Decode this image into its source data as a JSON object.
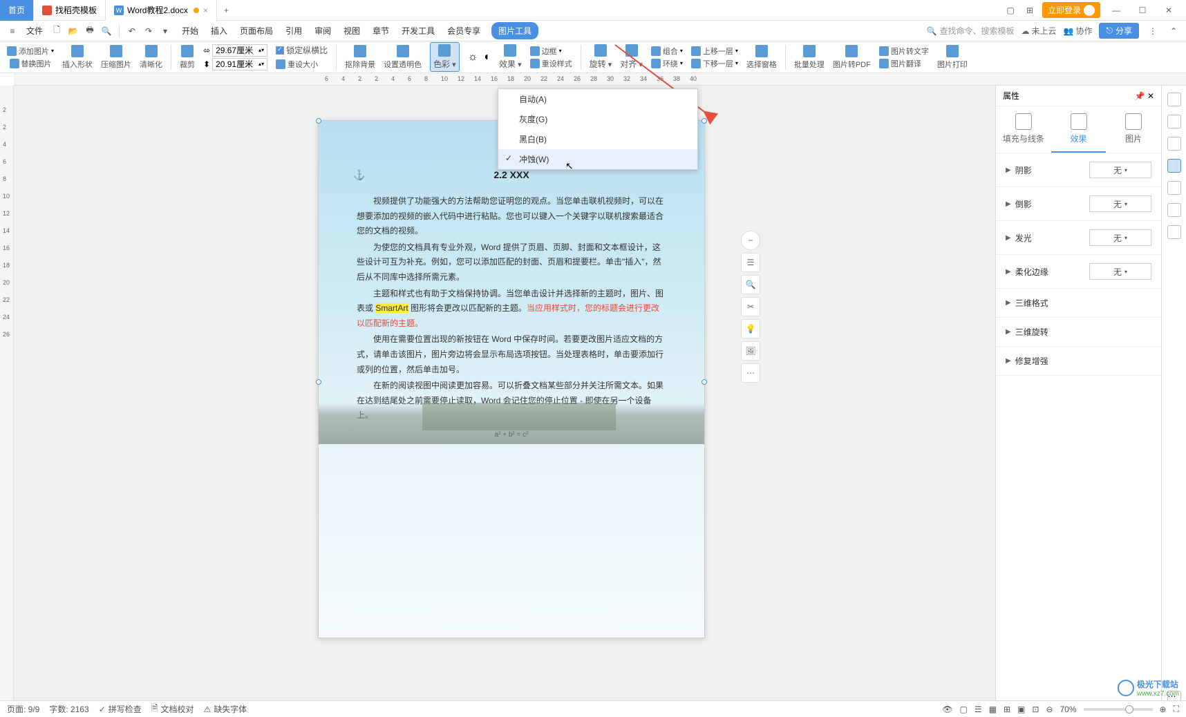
{
  "titlebar": {
    "home": "首页",
    "tab1": "找稻壳模板",
    "tab2": "Word教程2.docx",
    "login": "立即登录"
  },
  "menubar": {
    "file": "文件",
    "tabs": [
      "开始",
      "插入",
      "页面布局",
      "引用",
      "审阅",
      "视图",
      "章节",
      "开发工具",
      "会员专享",
      "图片工具"
    ],
    "search_placeholder": "查找命令、搜索模板",
    "cloud": "未上云",
    "collab": "协作",
    "share": "分享"
  },
  "toolbar": {
    "add_image": "添加图片",
    "replace_image": "替换图片",
    "insert_shape": "插入形状",
    "compress": "压缩图片",
    "sharpen": "清晰化",
    "crop": "裁剪",
    "width": "29.67厘米",
    "height": "20.91厘米",
    "lock_ratio": "锁定纵横比",
    "reset_size": "重设大小",
    "remove_bg": "抠除背景",
    "set_transparent": "设置透明色",
    "color": "色彩",
    "effect": "效果",
    "border": "边框",
    "reset_style": "重设样式",
    "rotate": "旋转",
    "align": "对齐",
    "combine": "组合",
    "wrap": "环绕",
    "move_up": "上移一层",
    "move_down": "下移一层",
    "select_pane": "选择窗格",
    "batch": "批量处理",
    "to_pdf": "图片转PDF",
    "to_text": "图片转文字",
    "translate": "图片翻译",
    "print": "图片打印"
  },
  "color_dropdown": {
    "auto": "自动(A)",
    "gray": "灰度(G)",
    "bw": "黑白(B)",
    "washout": "冲蚀(W)"
  },
  "ruler_h": [
    "6",
    "4",
    "2",
    "2",
    "4",
    "6",
    "8",
    "10",
    "12",
    "14",
    "16",
    "18",
    "20",
    "22",
    "24",
    "26",
    "28",
    "30",
    "32",
    "34",
    "36",
    "38",
    "40"
  ],
  "ruler_v": [
    "2",
    "2",
    "4",
    "6",
    "8",
    "10",
    "12",
    "14",
    "16",
    "18",
    "20",
    "22",
    "24",
    "26"
  ],
  "document": {
    "title": "2.2 XXX",
    "p1": "视频提供了功能强大的方法帮助您证明您的观点。当您单击联机视频时，可以在想要添加的视频的嵌入代码中进行粘贴。您也可以键入一个关键字以联机搜索最适合您的文档的视频。",
    "p2": "为使您的文档具有专业外观，Word 提供了页眉、页脚、封面和文本框设计，这些设计可互为补充。例如，您可以添加匹配的封面、页眉和提要栏。单击\"插入\"，然后从不同库中选择所需元素。",
    "p3a": "主题和样式也有助于文档保持协调。当您单击设计并选择新的主题时，图片、图表或 ",
    "p3_hl": "SmartArt",
    "p3b": " 图形将会更改以匹配新的主题。",
    "p3_red": "当应用样式时，您的标题会进行更改以匹配新的主题。",
    "p4": "使用在需要位置出现的新按钮在 Word 中保存时间。若要更改图片适应文档的方式，请单击该图片，图片旁边将会显示布局选项按钮。当处理表格时，单击要添加行或列的位置，然后单击加号。",
    "p5": "在新的阅读视图中阅读更加容易。可以折叠文档某些部分并关注所需文本。如果在达到结尾处之前需要停止读取，Word 会记住您的停止位置 - 即使在另一个设备上。",
    "formula": "a² + b² = c²"
  },
  "right_panel": {
    "title": "属性",
    "tabs": [
      "填充与线条",
      "效果",
      "图片"
    ],
    "sections": {
      "shadow": "阴影",
      "reflection": "倒影",
      "glow": "发光",
      "soft_edge": "柔化边缘",
      "three_d": "三维格式",
      "three_d_rotate": "三维旋转",
      "enhance": "修复增强"
    },
    "none": "无"
  },
  "status": {
    "page": "页面: 9/9",
    "words": "字数: 2163",
    "spell": "拼写检查",
    "proof": "文档校对",
    "missing_font": "缺失字体",
    "zoom": "70%"
  },
  "watermark": {
    "name": "极光下载站",
    "url": "www.xz7.com"
  }
}
